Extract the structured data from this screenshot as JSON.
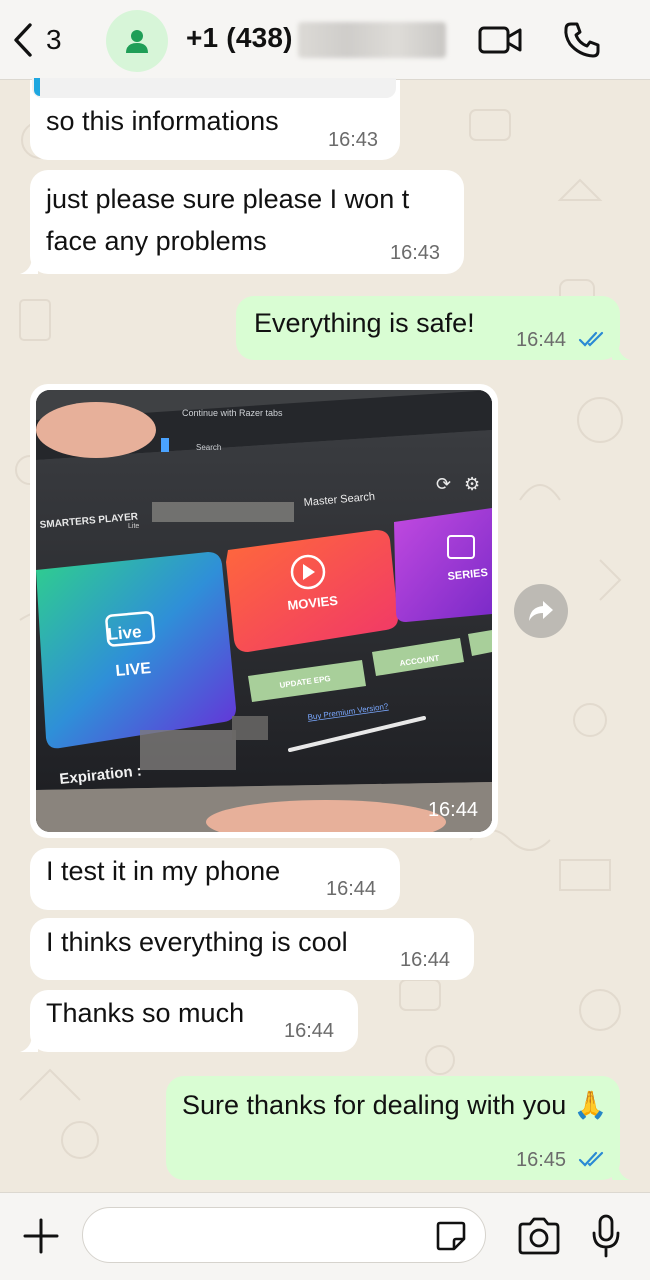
{
  "header": {
    "back_count": "3",
    "contact_name": "+1 (438)",
    "icons": {
      "back": "chevron-left-icon",
      "avatar": "person-icon",
      "video": "video-camera-icon",
      "call": "phone-icon"
    }
  },
  "messages": [
    {
      "direction": "in",
      "text": "so this informations",
      "time": "16:43"
    },
    {
      "direction": "in",
      "text": "just please sure please I won t face any problems",
      "time": "16:43"
    },
    {
      "direction": "out",
      "text": "Everything is safe!",
      "time": "16:44",
      "status": "read"
    },
    {
      "direction": "in",
      "type": "image",
      "time": "16:44"
    },
    {
      "direction": "in",
      "text": "I test it in my phone",
      "time": "16:44"
    },
    {
      "direction": "in",
      "text": "I thinks everything is cool",
      "time": "16:44"
    },
    {
      "direction": "in",
      "text": "Thanks so much",
      "time": "16:44"
    },
    {
      "direction": "out",
      "text": "Sure thanks for dealing with you 🙏",
      "time": "16:45",
      "status": "read"
    }
  ],
  "photo": {
    "brand": "SMARTERS PLAYER",
    "brand_sub": "Lite",
    "search": "Master Search",
    "tiles": [
      "LIVE",
      "MOVIES",
      "SERIES"
    ],
    "live_badge": "Live",
    "buttons": [
      "UPDATE EPG",
      "ACCOUNT"
    ],
    "premium_link": "Buy Premium Version?",
    "expiration": "Expiration :",
    "taskbar_text": "Continue with Razer tabs",
    "search_box": "Search"
  },
  "composer": {
    "placeholder": ""
  },
  "colors": {
    "outgoing_bubble": "#d9fdd3",
    "incoming_bubble": "#ffffff",
    "read_tick": "#2a8ad4",
    "avatar_bg": "#d7f5d8",
    "avatar_icon": "#1f9e57"
  }
}
